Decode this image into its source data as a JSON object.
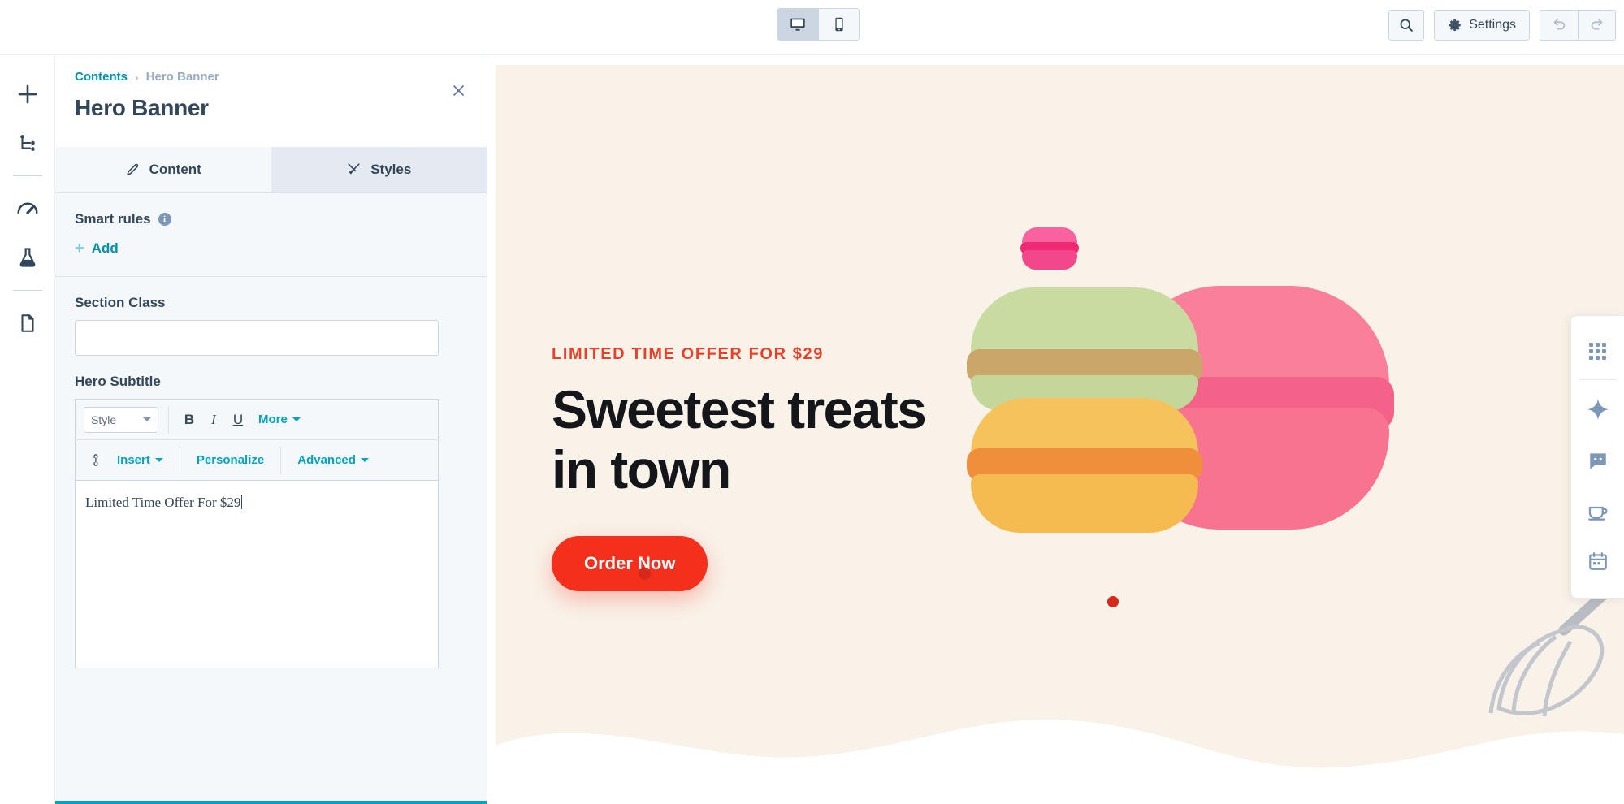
{
  "topbar": {
    "device_desktop_label": "desktop-view",
    "device_mobile_label": "mobile-view",
    "search_label": "search-icon",
    "settings_label": "Settings",
    "undo_label": "undo-icon",
    "redo_label": "redo-icon"
  },
  "rail": {
    "items": [
      {
        "icon": "plus-icon",
        "name": "add-module"
      },
      {
        "icon": "tree-icon",
        "name": "content-tree"
      },
      {
        "icon": "gauge-icon",
        "name": "optimize"
      },
      {
        "icon": "flask-icon",
        "name": "experiments"
      },
      {
        "icon": "document-icon",
        "name": "page-details"
      }
    ]
  },
  "panel": {
    "breadcrumb_root": "Contents",
    "breadcrumb_separator": "›",
    "breadcrumb_current": "Hero Banner",
    "title": "Hero Banner",
    "close_label": "close-icon",
    "tabs": [
      {
        "label": "Content",
        "icon": "pencil-icon",
        "active": true
      },
      {
        "label": "Styles",
        "icon": "brush-icon",
        "active": false
      }
    ],
    "smart_rules": {
      "title": "Smart rules",
      "info": "i",
      "add_label": "Add",
      "add_plus": "+"
    },
    "section_class": {
      "label": "Section Class",
      "value": "",
      "placeholder": ""
    },
    "hero_subtitle": {
      "label": "Hero Subtitle",
      "value": "Limited Time Offer For $29",
      "toolbar_row1": {
        "style_label": "Style",
        "bold": "B",
        "italic": "I",
        "underline": "U",
        "more": "More"
      },
      "toolbar_row2": {
        "link_icon": "link-icon",
        "insert": "Insert",
        "personalize": "Personalize",
        "advanced": "Advanced"
      }
    }
  },
  "preview": {
    "eyebrow": "LIMITED TIME OFFER FOR $29",
    "headline_line1": "Sweetest treats",
    "headline_line2": "in town",
    "cta_label": "Order Now",
    "background_color": "#f9f2e9",
    "accent_color": "#f4301c",
    "eyebrow_color": "#e8412a"
  },
  "float_panel": {
    "items": [
      {
        "icon": "grid-dots-icon",
        "name": "apps-grid"
      },
      {
        "icon": "sparkle-icon",
        "name": "ai-assistant"
      },
      {
        "icon": "chat-icon",
        "name": "chat"
      },
      {
        "icon": "coffee-cup-icon",
        "name": "breeze"
      },
      {
        "icon": "calendar-icon",
        "name": "meetings"
      }
    ]
  }
}
